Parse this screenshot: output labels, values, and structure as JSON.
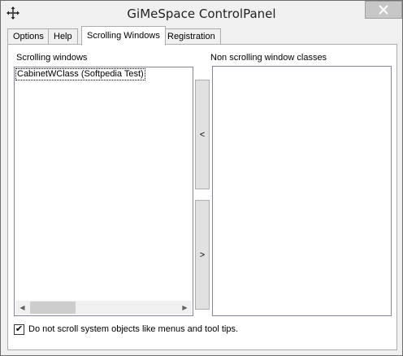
{
  "window": {
    "title": "GiMeSpace ControlPanel",
    "app_icon": "cursor-move-icon",
    "close_icon": "close-icon"
  },
  "tabs": [
    {
      "label": "Options",
      "active": false
    },
    {
      "label": "Help",
      "active": false
    },
    {
      "label": "Scrolling Windows",
      "active": true
    },
    {
      "label": "Registration",
      "active": false
    }
  ],
  "scrolling_windows": {
    "label": "Scrolling windows",
    "items": [
      "CabinetWClass (Softpedia Test)"
    ]
  },
  "non_scrolling": {
    "label": "Non scrolling window classes",
    "items": []
  },
  "buttons": {
    "move_left": "<",
    "move_right": ">"
  },
  "checkbox": {
    "label": "Do not scroll system objects like menus and tool tips.",
    "checked": true,
    "mark": "✔"
  },
  "scrollbar": {
    "left_arrow": "◀",
    "right_arrow": "▶"
  }
}
